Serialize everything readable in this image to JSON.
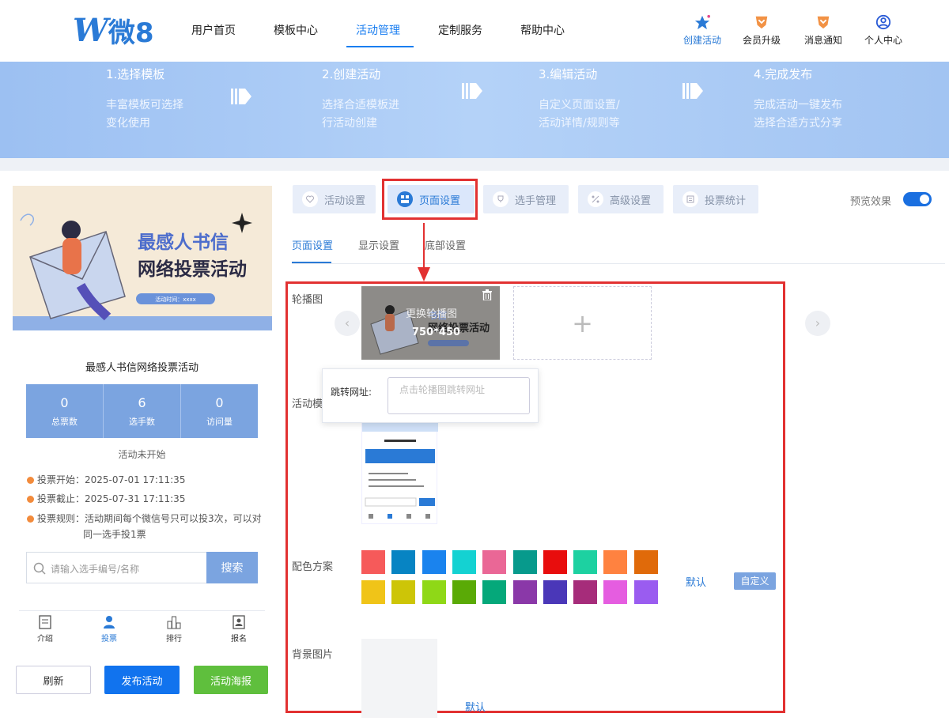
{
  "header": {
    "logo_text": "微8",
    "nav": [
      "用户首页",
      "模板中心",
      "活动管理",
      "定制服务",
      "帮助中心"
    ],
    "active_nav": "活动管理",
    "icons": [
      {
        "label": "创建活动",
        "icon": "star-icon",
        "color": "#2a7ad6"
      },
      {
        "label": "会员升级",
        "icon": "crown-icon",
        "color": "#f29245"
      },
      {
        "label": "消息通知",
        "icon": "bell-icon",
        "color": "#f29245"
      },
      {
        "label": "个人中心",
        "icon": "user-icon",
        "color": "#2a5bd6"
      }
    ]
  },
  "steps": [
    {
      "title": "1.选择模板",
      "line1": "丰富模板可选择",
      "line2": "变化使用"
    },
    {
      "title": "2.创建活动",
      "line1": "选择合适模板进",
      "line2": "行活动创建"
    },
    {
      "title": "3.编辑活动",
      "line1": "自定义页面设置/",
      "line2": "活动详情/规则等"
    },
    {
      "title": "4.完成发布",
      "line1": "完成活动一键发布",
      "line2": "选择合适方式分享"
    }
  ],
  "preview": {
    "cover_title1": "最感人书信",
    "cover_title2": "网络投票活动",
    "cover_time": "活动时间：xxxx",
    "activity_name": "最感人书信网络投票活动",
    "stats": [
      {
        "value": "0",
        "label": "总票数"
      },
      {
        "value": "6",
        "label": "选手数"
      },
      {
        "value": "0",
        "label": "访问量"
      }
    ],
    "status": "活动未开始",
    "start": "投票开始：2025-07-01 17:11:35",
    "end": "投票截止：2025-07-31 17:11:35",
    "rule1": "投票规则：活动期间每个微信号只可以投3次，可以对",
    "rule2": "同一选手投1票",
    "search_placeholder": "请输入选手编号/名称",
    "search_button": "搜索",
    "tabs": [
      "介绍",
      "投票",
      "排行",
      "报名"
    ],
    "buttons": {
      "refresh": "刷新",
      "publish": "发布活动",
      "poster": "活动海报"
    }
  },
  "settings": {
    "tabs": [
      "活动设置",
      "页面设置",
      "选手管理",
      "高级设置",
      "投票统计"
    ],
    "active_tab": "页面设置",
    "preview_label": "预览效果",
    "subtabs": [
      "页面设置",
      "显示设置",
      "底部设置"
    ],
    "carousel_label": "轮播图",
    "carousel_replace": "更换轮播图",
    "carousel_size": "750*450",
    "jump_label": "跳转网址:",
    "jump_placeholder": "点击轮播图跳转网址",
    "template_label": "活动模",
    "color_label": "配色方案",
    "colors_row1": [
      "#f65a5a",
      "#0784c3",
      "#1a83ee",
      "#14d2d2",
      "#ea6796",
      "#079a8c",
      "#e80d0d",
      "#1dd1a1",
      "#ff8240",
      "#e06a0a"
    ],
    "colors_row2": [
      "#f0c418",
      "#cdc507",
      "#8fd817",
      "#5aaa06",
      "#05a87a",
      "#8a38a8",
      "#4a37b8",
      "#a62c7a",
      "#e55de0",
      "#9a5cf0"
    ],
    "default_label": "默认",
    "custom_label": "自定义",
    "bg_label": "背景图片",
    "bg_default": "默认"
  }
}
